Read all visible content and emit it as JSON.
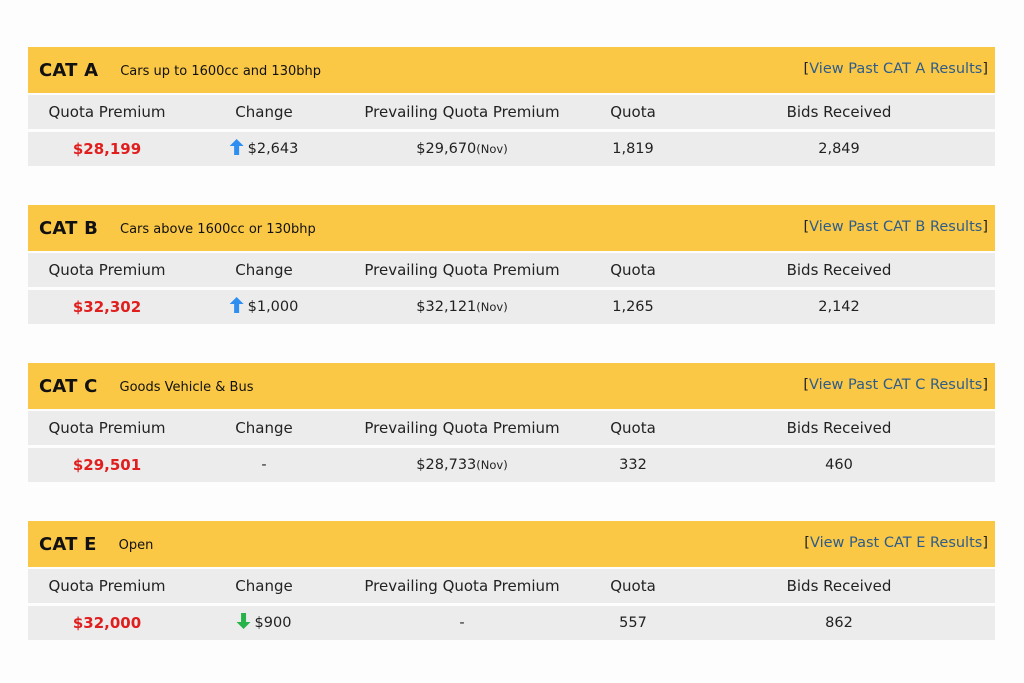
{
  "colors": {
    "header_bg": "#fbc846",
    "row_bg": "#ececec",
    "premium_red": "#e01e1e",
    "arrow_up_blue": "#2f8ff0",
    "arrow_down_green": "#27b34a",
    "link_blue": "#2e5c8a"
  },
  "column_headers": {
    "quota_premium": "Quota Premium",
    "change": "Change",
    "prevailing": "Prevailing Quota Premium",
    "quota": "Quota",
    "bids": "Bids Received"
  },
  "categories": [
    {
      "name": "CAT A",
      "description": "Cars up to 1600cc and 130bhp",
      "link_open": "[",
      "link_text": "View Past CAT A Results",
      "link_close": "]",
      "quota_premium": "$28,199",
      "change_icon": "arrow-up-icon",
      "change": "$2,643",
      "prevailing": "$29,670",
      "prevailing_month": "(Nov)",
      "quota": "1,819",
      "bids": "2,849"
    },
    {
      "name": "CAT B",
      "description": "Cars above 1600cc or 130bhp",
      "link_open": "[",
      "link_text": "View Past CAT B Results",
      "link_close": "]",
      "quota_premium": "$32,302",
      "change_icon": "arrow-up-icon",
      "change": "$1,000",
      "prevailing": "$32,121",
      "prevailing_month": "(Nov)",
      "quota": "1,265",
      "bids": "2,142"
    },
    {
      "name": "CAT C",
      "description": "Goods Vehicle & Bus",
      "link_open": "[",
      "link_text": "View Past CAT C Results",
      "link_close": "]",
      "quota_premium": "$29,501",
      "change_icon": "",
      "change": "-",
      "prevailing": "$28,733",
      "prevailing_month": "(Nov)",
      "quota": "332",
      "bids": "460"
    },
    {
      "name": "CAT E",
      "description": "Open",
      "link_open": "[",
      "link_text": "View Past CAT E Results",
      "link_close": "]",
      "quota_premium": "$32,000",
      "change_icon": "arrow-down-icon",
      "change": "$900",
      "prevailing": "-",
      "prevailing_month": "",
      "quota": "557",
      "bids": "862"
    }
  ]
}
